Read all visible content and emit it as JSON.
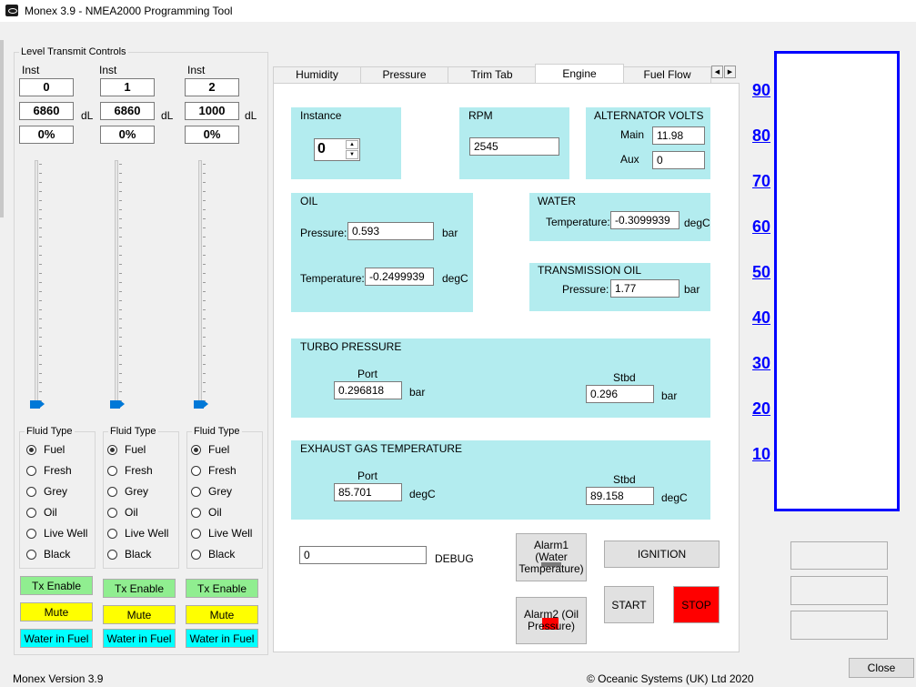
{
  "window": {
    "title": "Monex 3.9 - NMEA2000 Programming Tool"
  },
  "left": {
    "group_title": "Level Transmit Controls",
    "inst_label": "Inst",
    "unit_label": "dL",
    "channels": [
      {
        "inst": "0",
        "level": "6860",
        "percent": "0%",
        "level_fraction": 0.0,
        "fluid_selected": "Fuel"
      },
      {
        "inst": "1",
        "level": "6860",
        "percent": "0%",
        "level_fraction": 0.0,
        "fluid_selected": "Fuel"
      },
      {
        "inst": "2",
        "level": "1000",
        "percent": "0%",
        "level_fraction": 0.0,
        "fluid_selected": "Fuel"
      }
    ],
    "fluid_type_title": "Fluid Type",
    "fluid_options": [
      "Fuel",
      "Fresh",
      "Grey",
      "Oil",
      "Live Well",
      "Black"
    ],
    "tx_enable": "Tx Enable",
    "mute": "Mute",
    "water_in_fuel": "Water in Fuel"
  },
  "tabs": [
    "Humidity",
    "Pressure",
    "Trim Tab",
    "Engine",
    "Fuel Flow"
  ],
  "active_tab": "Engine",
  "engine": {
    "instance_label": "Instance",
    "instance_value": "0",
    "rpm_label": "RPM",
    "rpm_value": "2545",
    "alt_label": "ALTERNATOR VOLTS",
    "alt_main_label": "Main",
    "alt_main_value": "11.98",
    "alt_aux_label": "Aux",
    "alt_aux_value": "0",
    "oil_label": "OIL",
    "oil_pressure_label": "Pressure:",
    "oil_pressure_value": "0.593",
    "oil_pressure_unit": "bar",
    "oil_temp_label": "Temperature:",
    "oil_temp_value": "-0.2499939",
    "oil_temp_unit": "degC",
    "water_label": "WATER",
    "water_temp_label": "Temperature:",
    "water_temp_value": "-0.3099939",
    "water_temp_unit": "degC",
    "trans_label": "TRANSMISSION OIL",
    "trans_pressure_label": "Pressure:",
    "trans_pressure_value": "1.77",
    "trans_pressure_unit": "bar",
    "turbo_label": "TURBO PRESSURE",
    "turbo_port_label": "Port",
    "turbo_port_value": "0.296818",
    "turbo_port_unit": "bar",
    "turbo_stbd_label": "Stbd",
    "turbo_stbd_value": "0.296",
    "turbo_stbd_unit": "bar",
    "egt_label": "EXHAUST GAS TEMPERATURE",
    "egt_port_label": "Port",
    "egt_port_value": "85.701",
    "egt_port_unit": "degC",
    "egt_stbd_label": "Stbd",
    "egt_stbd_value": "89.158",
    "egt_stbd_unit": "degC",
    "debug_value": "0",
    "debug_label": "DEBUG",
    "alarm1": "Alarm1 (Water Temperature)",
    "alarm2": "Alarm2 (Oil Pressure)",
    "ignition": "IGNITION",
    "start": "START",
    "stop": "STOP"
  },
  "gauge": {
    "labels": [
      "90",
      "80",
      "70",
      "60",
      "50",
      "40",
      "30",
      "20",
      "10"
    ]
  },
  "footer": {
    "version": "Monex Version 3.9",
    "copyright": "© Oceanic Systems (UK) Ltd 2020",
    "close": "Close"
  },
  "colors": {
    "panel": "#b3ecef",
    "gauge_blue": "#0000ff",
    "tx": "#90ee90",
    "mute": "#ffff00",
    "water_in_fuel": "#00ffff",
    "stop": "#ff0000"
  }
}
